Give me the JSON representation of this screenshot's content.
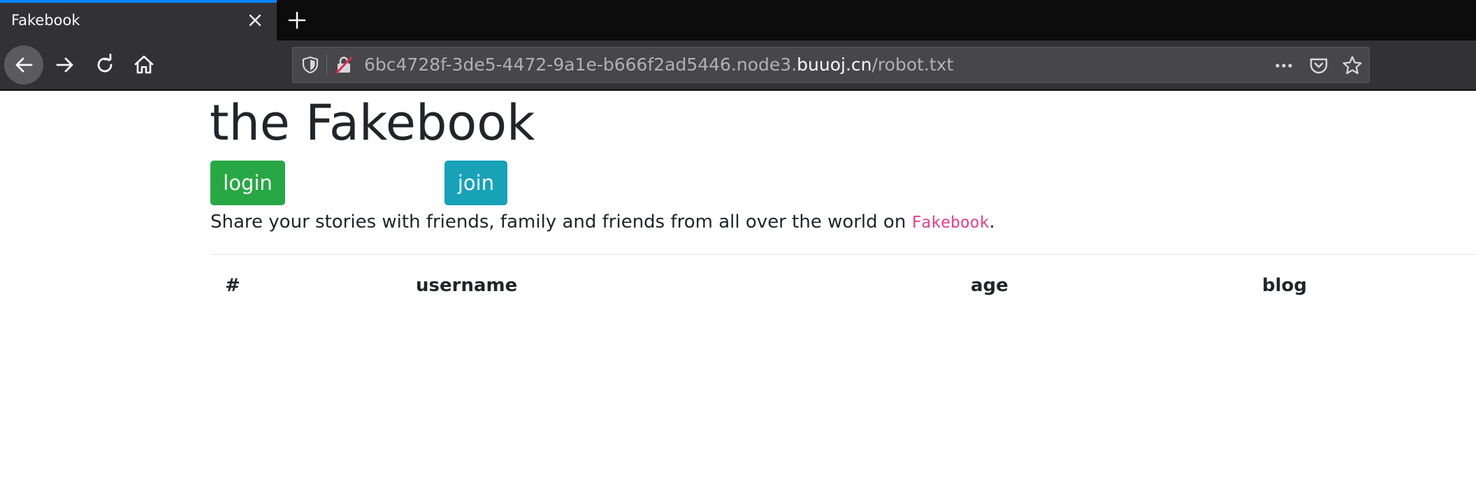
{
  "browser": {
    "tab": {
      "title": "Fakebook"
    },
    "url": {
      "prefix": "6bc4728f-3de5-4472-9a1e-b666f2ad5446.node3.",
      "host": "buuoj.cn",
      "path": "/robot.txt"
    },
    "icons": {
      "close": "close-icon",
      "new_tab": "plus-icon",
      "back": "arrow-left-icon",
      "forward": "arrow-right-icon",
      "reload": "reload-icon",
      "home": "home-icon",
      "shield": "shield-icon",
      "insecure": "insecure-lock-icon",
      "more": "more-icon",
      "pocket": "pocket-icon",
      "bookmark": "star-icon"
    },
    "colors": {
      "chrome": "#323234",
      "tabstrip": "#0c0c0d",
      "accent": "#0a84ff"
    }
  },
  "page": {
    "title": "the Fakebook",
    "buttons": {
      "login": "login",
      "join": "join"
    },
    "tagline": {
      "text": "Share your stories with friends, family and friends from all over the world on ",
      "brand": "Fakebook",
      "suffix": "."
    },
    "table": {
      "headers": [
        "#",
        "username",
        "age",
        "blog"
      ],
      "rows": []
    },
    "colors": {
      "login": "#28a745",
      "join": "#17a2b8",
      "brand": "#e83e8c"
    }
  }
}
